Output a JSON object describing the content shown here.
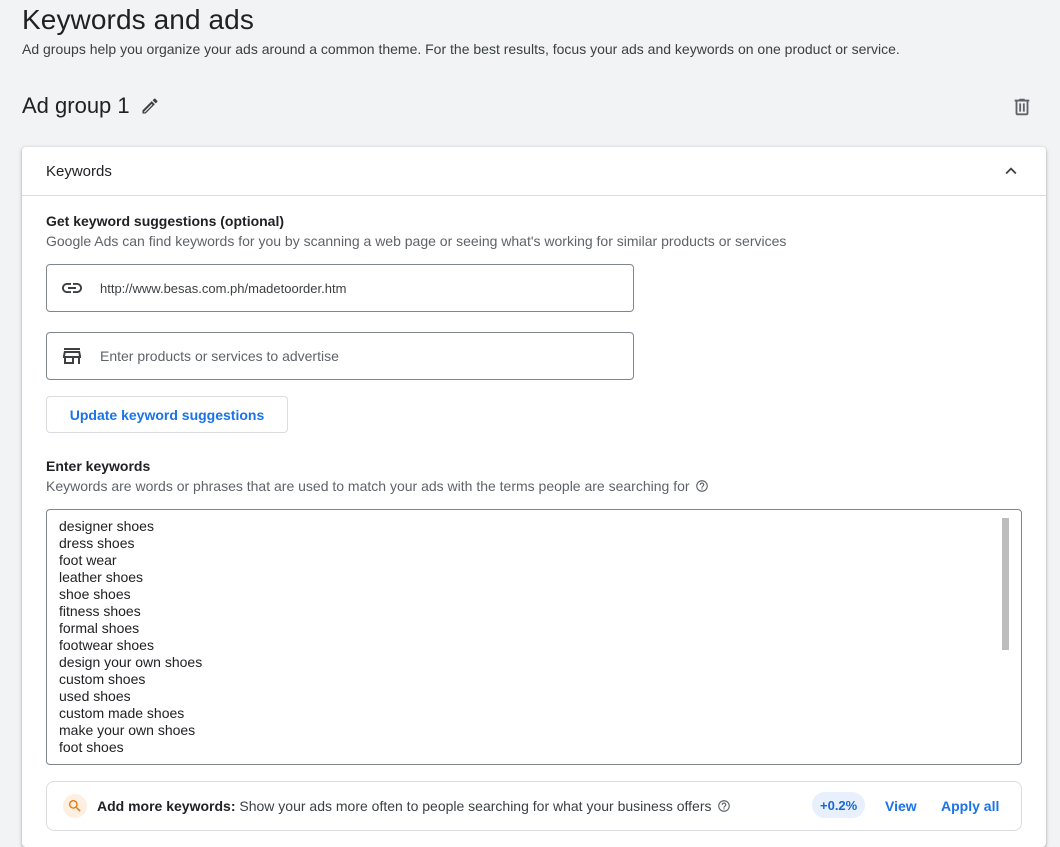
{
  "page": {
    "title": "Keywords and ads",
    "subtitle": "Ad groups help you organize your ads around a common theme. For the best results, focus your ads and keywords on one product or service."
  },
  "ad_group": {
    "title": "Ad group 1",
    "edit_icon": "pencil-icon",
    "delete_icon": "trash-icon"
  },
  "keywords_card": {
    "header": "Keywords",
    "collapse_icon": "chevron-up-icon",
    "suggestions": {
      "title": "Get keyword suggestions (optional)",
      "description": "Google Ads can find keywords for you by scanning a web page or seeing what's working for similar products or services",
      "url_value": "http://www.besas.com.ph/madetoorder.htm",
      "url_icon": "link-icon",
      "products_placeholder": "Enter products or services to advertise",
      "products_icon": "store-icon",
      "update_button": "Update keyword suggestions"
    },
    "enter": {
      "title": "Enter keywords",
      "description": "Keywords are words or phrases that are used to match your ads with the terms people are searching for",
      "help_icon": "help-circle-icon",
      "keywords": [
        "designer shoes",
        "dress shoes",
        "foot wear",
        "leather shoes",
        "shoe shoes",
        "fitness shoes",
        "formal shoes",
        "footwear shoes",
        "design your own shoes",
        "custom shoes",
        "used shoes",
        "custom made shoes",
        "make your own shoes",
        "foot shoes"
      ]
    },
    "add_more": {
      "icon": "search-icon",
      "bold_label": "Add more keywords:",
      "text": "Show your ads more often to people searching for what your business offers",
      "percent": "+0.2%",
      "view_label": "View",
      "apply_label": "Apply all"
    }
  },
  "colors": {
    "accent": "#1a73e8",
    "background": "#f1f3f4",
    "chip_bg": "#e8f0fe"
  }
}
